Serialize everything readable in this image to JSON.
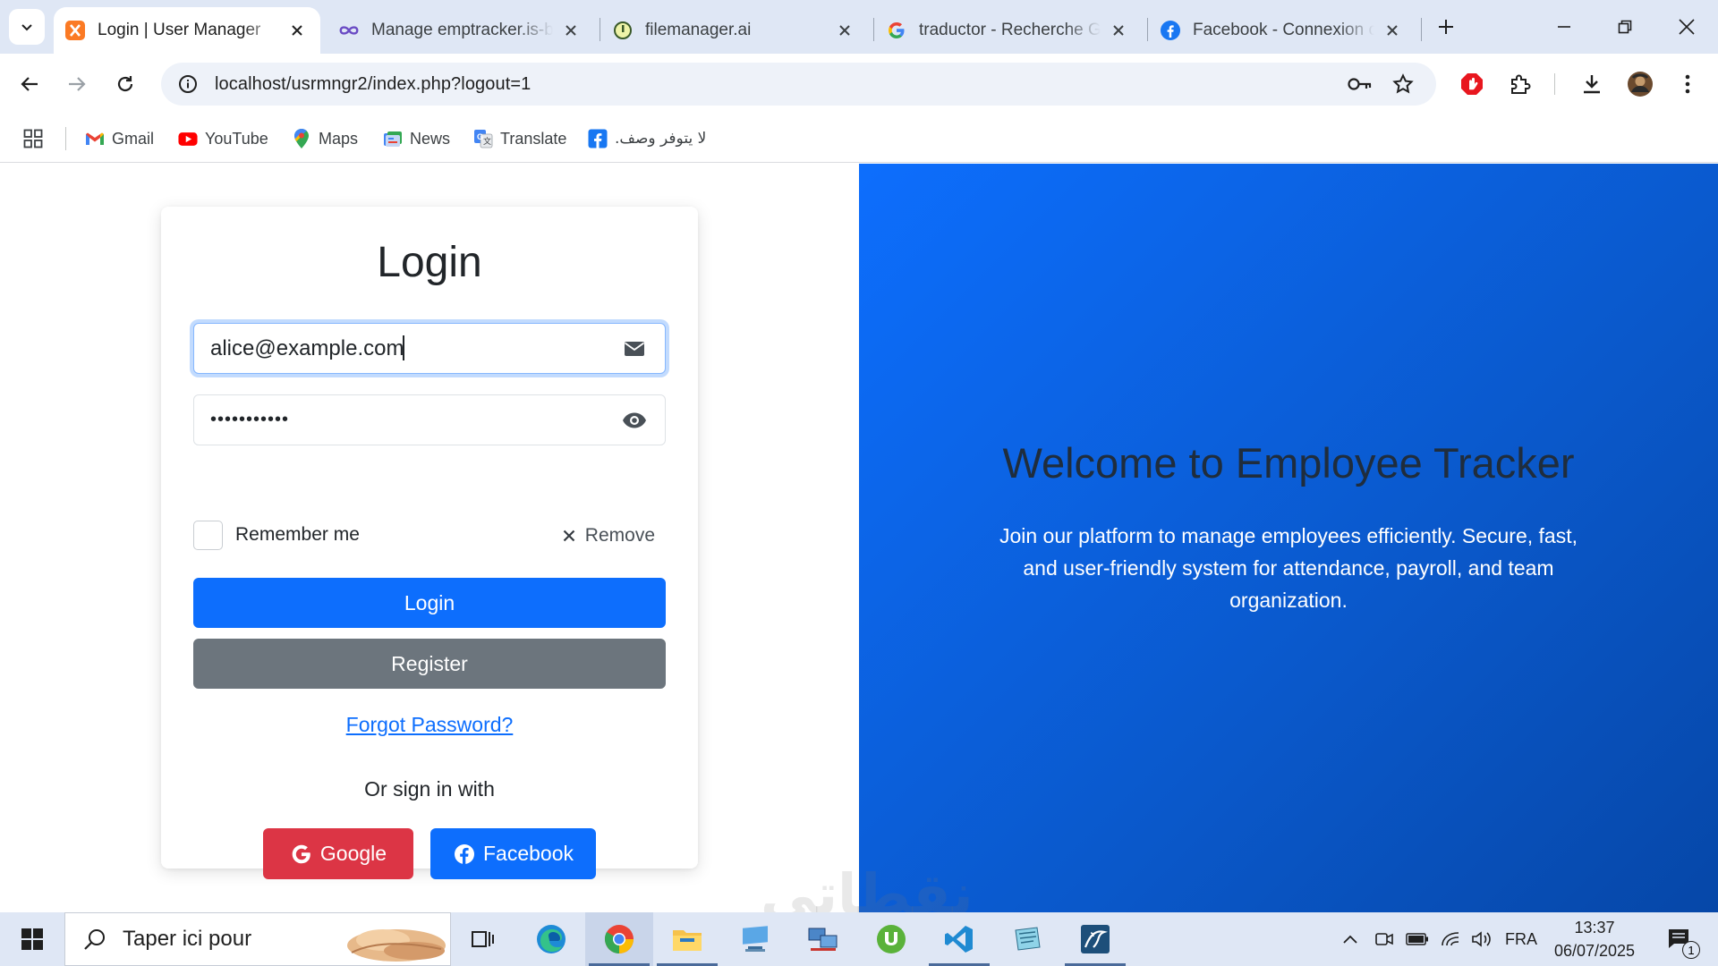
{
  "browser": {
    "tabs": [
      {
        "title": "Login | User Manager",
        "icon": "xampp-icon",
        "active": true
      },
      {
        "title": "Manage emptracker.is-be",
        "icon": "infinityfree-icon",
        "active": false
      },
      {
        "title": "filemanager.ai",
        "icon": "filemanager-icon",
        "active": false
      },
      {
        "title": "traductor - Recherche Go",
        "icon": "google-icon",
        "active": false
      },
      {
        "title": "Facebook - Connexion ou",
        "icon": "facebook-icon",
        "active": false
      }
    ],
    "url": "localhost/usrmngr2/index.php?logout=1",
    "bookmarks": [
      {
        "label": "Gmail",
        "icon": "gmail-icon"
      },
      {
        "label": "YouTube",
        "icon": "youtube-icon"
      },
      {
        "label": "Maps",
        "icon": "maps-icon"
      },
      {
        "label": "News",
        "icon": "news-icon"
      },
      {
        "label": "Translate",
        "icon": "translate-icon"
      },
      {
        "label": "لا يتوفر وصف.",
        "icon": "facebook-icon"
      }
    ]
  },
  "login": {
    "heading": "Login",
    "email_value": "alice@example.com",
    "password_value": "•••••••••••",
    "remember_label": "Remember me",
    "remove_label": "Remove",
    "login_button": "Login",
    "register_button": "Register",
    "forgot_link": "Forgot Password?",
    "or_sign_in": "Or sign in with",
    "google_button": "Google",
    "facebook_button": "Facebook"
  },
  "welcome": {
    "title": "Welcome to Employee Tracker",
    "text": "Join our platform to manage employees efficiently. Secure, fast, and user-friendly system for attendance, payroll, and team organization."
  },
  "watermark": "نقطاتي",
  "taskbar": {
    "search_placeholder": "Taper ici pour",
    "language": "FRA",
    "time": "13:37",
    "date": "06/07/2025",
    "notification_count": "1"
  },
  "colors": {
    "primary": "#0d6efd",
    "secondary": "#6c757d",
    "danger": "#dc3545",
    "tabstrip": "#dfe7f5"
  }
}
